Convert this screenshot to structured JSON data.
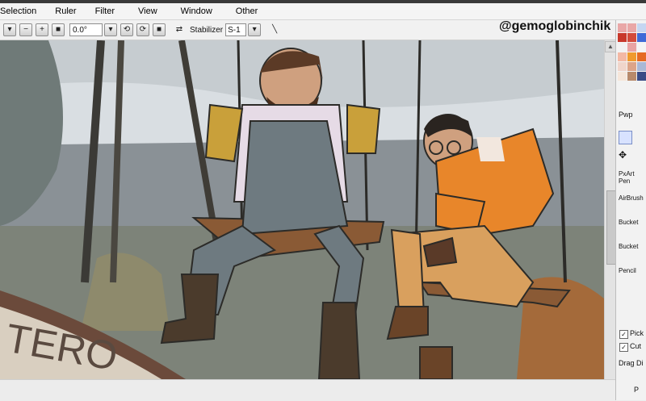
{
  "menubar": {
    "items": [
      {
        "label": "Selection"
      },
      {
        "label": "Ruler"
      },
      {
        "label": "Filter"
      },
      {
        "label": "View"
      },
      {
        "label": "Window"
      },
      {
        "label": "Other"
      }
    ]
  },
  "toolbar": {
    "angle_value": "0.0°",
    "stabilizer_label": "Stabilizer",
    "stabilizer_value": "S-1"
  },
  "watermark": "@gemoglobinchik",
  "right_panel": {
    "tab_label": "Pwp",
    "tools": [
      {
        "name": "PxArt Pen"
      },
      {
        "name": "AirBrush"
      },
      {
        "name": "Bucket"
      },
      {
        "name": "Bucket"
      },
      {
        "name": "Pencil"
      }
    ],
    "checks": [
      {
        "label": "Pick",
        "checked": true
      },
      {
        "label": "Cut",
        "checked": true
      }
    ],
    "drag_label": "Drag Di",
    "bottom_letter": "P"
  },
  "colors": {
    "swatches": [
      "#e9a7a7",
      "#e9a7a7",
      "#c5d6f2",
      "#c8382b",
      "#d24a3b",
      "#3f6ad7",
      "#f2f2f2",
      "#e9a4a4",
      "#f5f5f5",
      "#f3b8a4",
      "#f09a2e",
      "#e56a23",
      "#f0d5cb",
      "#dca489",
      "#a9b8d6",
      "#f6e6da",
      "#b88a6b",
      "#3a4c86"
    ]
  }
}
